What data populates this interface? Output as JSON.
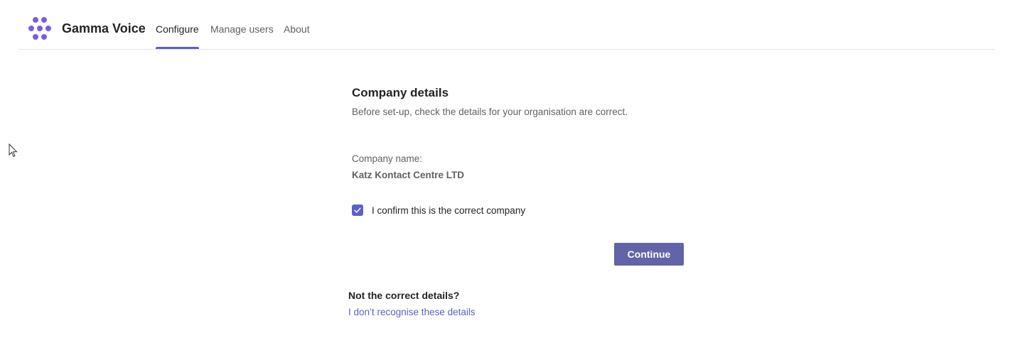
{
  "app": {
    "name": "Gamma Voice",
    "logo_icon": "gamma-dots-logo-icon",
    "accent_color": "#5b5fc7",
    "logo_color": "#7b5ce0"
  },
  "nav": {
    "tabs": [
      {
        "label": "Configure",
        "active": true
      },
      {
        "label": "Manage users",
        "active": false
      },
      {
        "label": "About",
        "active": false
      }
    ]
  },
  "company": {
    "heading": "Company details",
    "subtitle": "Before set-up, check the details for your organisation are correct.",
    "name_label": "Company name:",
    "name_value": "Katz Kontact Centre LTD",
    "confirm_label": "I confirm this is the correct company",
    "confirm_checked": true
  },
  "actions": {
    "continue_label": "Continue",
    "button_color": "#6264a7"
  },
  "footer": {
    "question": "Not the correct details?",
    "link_text": "I don’t recognise these details"
  }
}
